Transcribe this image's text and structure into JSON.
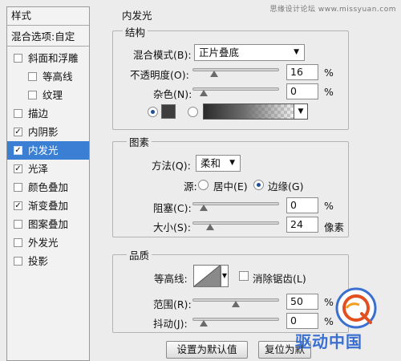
{
  "watermark": "思缘设计论坛 www.missyuan.com",
  "sidebar": {
    "header": "样式",
    "blend_options": "混合选项:自定",
    "items": [
      {
        "label": "斜面和浮雕",
        "checked": false,
        "indent": false
      },
      {
        "label": "等高线",
        "checked": false,
        "indent": true
      },
      {
        "label": "纹理",
        "checked": false,
        "indent": true
      },
      {
        "label": "描边",
        "checked": false,
        "indent": false
      },
      {
        "label": "内阴影",
        "checked": true,
        "indent": false
      },
      {
        "label": "内发光",
        "checked": true,
        "indent": false,
        "selected": true
      },
      {
        "label": "光泽",
        "checked": true,
        "indent": false
      },
      {
        "label": "颜色叠加",
        "checked": false,
        "indent": false
      },
      {
        "label": "渐变叠加",
        "checked": true,
        "indent": false
      },
      {
        "label": "图案叠加",
        "checked": false,
        "indent": false
      },
      {
        "label": "外发光",
        "checked": false,
        "indent": false
      },
      {
        "label": "投影",
        "checked": false,
        "indent": false
      }
    ]
  },
  "panel": {
    "title": "内发光",
    "structure": {
      "legend": "结构",
      "blend_mode_label": "混合模式(B):",
      "blend_mode_value": "正片叠底",
      "opacity_label": "不透明度(O):",
      "opacity_value": "16",
      "opacity_fraction": 0.16,
      "noise_label": "杂色(N):",
      "noise_value": "0",
      "noise_fraction": 0.0,
      "percent": "%",
      "color_swatch": "#3e3e3e"
    },
    "elements": {
      "legend": "图素",
      "method_label": "方法(Q):",
      "method_value": "柔和",
      "source_label": "源:",
      "source_center": "居中(E)",
      "source_edge": "边缘(G)",
      "source_selected": "edge",
      "choke_label": "阻塞(C):",
      "choke_value": "0",
      "choke_fraction": 0.0,
      "size_label": "大小(S):",
      "size_value": "24",
      "size_fraction": 0.1,
      "percent": "%",
      "pixels": "像素"
    },
    "quality": {
      "legend": "品质",
      "contour_label": "等高线:",
      "antialias_label": "消除锯齿(L)",
      "antialias_checked": false,
      "range_label": "范围(R):",
      "range_value": "50",
      "range_fraction": 0.5,
      "jitter_label": "抖动(J):",
      "jitter_value": "0",
      "jitter_fraction": 0.0,
      "percent": "%"
    },
    "buttons": {
      "set_default": "设置为默认值",
      "reset_default": "复位为默"
    }
  },
  "brand": "驱动中国",
  "colors": {
    "selection": "#3b7fd4",
    "brand": "#3a6fd0"
  }
}
